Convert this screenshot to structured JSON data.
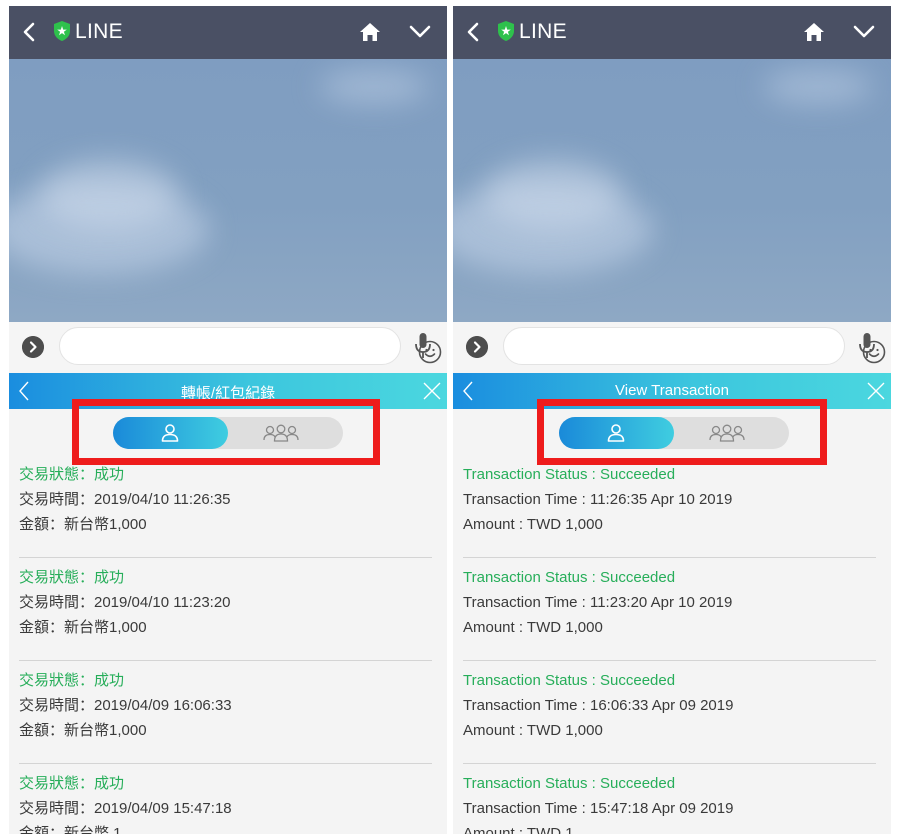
{
  "colors": {
    "topbar": "#4a5064",
    "panel_gradient_start": "#1a8ddf",
    "panel_gradient_end": "#4bd7df",
    "status_green": "#27ae5a",
    "highlight_red": "#ee1c1c",
    "shield_green": "#2ec14c"
  },
  "icons": {
    "back": "chevron-left-icon",
    "shield": "line-shield-icon",
    "home": "home-icon",
    "menu": "chevron-down-icon",
    "expand": "chevron-right-icon",
    "emoji": "smiley-icon",
    "voice": "microphone-icon",
    "panel_close": "close-icon",
    "single": "person-icon",
    "group": "group-icon"
  },
  "screens": [
    {
      "app_title": "LINE",
      "panel_title": "轉帳/紅包紀錄",
      "active_toggle": "single",
      "records": [
        {
          "status": "交易狀態：成功",
          "time": "交易時間：2019/04/10 11:26:35",
          "amount": "金額：新台幣1,000"
        },
        {
          "status": "交易狀態：成功",
          "time": "交易時間：2019/04/10 11:23:20",
          "amount": "金額：新台幣1,000"
        },
        {
          "status": "交易狀態：成功",
          "time": "交易時間：2019/04/09 16:06:33",
          "amount": "金額：新台幣1,000"
        },
        {
          "status": "交易狀態：成功",
          "time": "交易時間：2019/04/09 15:47:18",
          "amount": "金額：新台幣 1"
        }
      ]
    },
    {
      "app_title": "LINE",
      "panel_title": "View Transaction",
      "active_toggle": "single",
      "records": [
        {
          "status": "Transaction Status : Succeeded",
          "time": "Transaction Time : 11:26:35 Apr 10 2019",
          "amount": "Amount : TWD 1,000"
        },
        {
          "status": "Transaction Status : Succeeded",
          "time": "Transaction Time : 11:23:20 Apr 10 2019",
          "amount": "Amount : TWD 1,000"
        },
        {
          "status": "Transaction Status : Succeeded",
          "time": "Transaction Time : 16:06:33 Apr 09 2019",
          "amount": "Amount : TWD 1,000"
        },
        {
          "status": "Transaction Status : Succeeded",
          "time": "Transaction Time : 15:47:18 Apr 09 2019",
          "amount": "Amount : TWD 1"
        }
      ]
    }
  ]
}
